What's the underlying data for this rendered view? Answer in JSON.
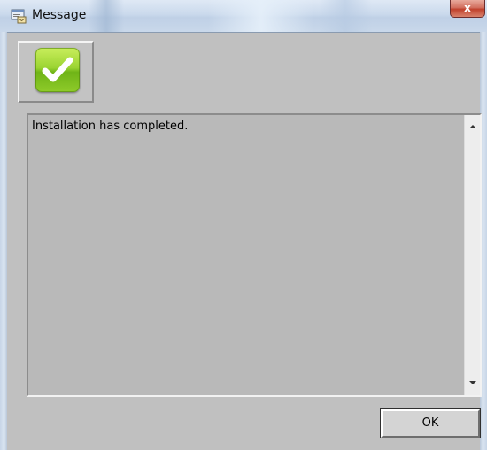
{
  "window": {
    "title": "Message",
    "app_icon": "message-app-icon",
    "close_label": "x"
  },
  "status_icon": "success-checkmark-icon",
  "message": {
    "text": "Installation has completed."
  },
  "buttons": {
    "ok_label": "OK"
  },
  "colors": {
    "client_background": "#c0c0c0",
    "message_background": "#b9b9b9",
    "check_green": "#8fcb2a",
    "close_red": "#c0412c"
  }
}
